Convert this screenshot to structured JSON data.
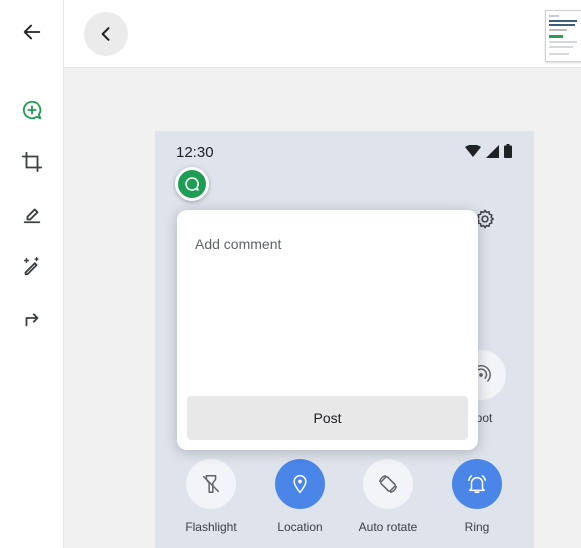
{
  "rail": {
    "items": [
      {
        "name": "back-arrow",
        "icon": "arrow-left-icon"
      },
      {
        "name": "add-comment",
        "icon": "add-comment-icon",
        "color": "#1f9d55"
      },
      {
        "name": "crop",
        "icon": "crop-icon"
      },
      {
        "name": "highlight",
        "icon": "highlighter-icon"
      },
      {
        "name": "magic-edit",
        "icon": "pen-sparkle-icon"
      },
      {
        "name": "share",
        "icon": "share-arrow-icon"
      }
    ]
  },
  "topbar": {
    "back_icon": "chevron-left-icon",
    "thumbnail_icon": "page-thumbnail"
  },
  "phone": {
    "time": "12:30",
    "status_icons": [
      "wifi-icon",
      "signal-icon",
      "battery-icon"
    ],
    "tiles": [
      {
        "label": "Flashlight",
        "icon": "flashlight-icon",
        "state": "off"
      },
      {
        "label": "Location",
        "icon": "location-pin-icon",
        "state": "on"
      },
      {
        "label": "Auto rotate",
        "icon": "auto-rotate-icon",
        "state": "off"
      },
      {
        "label": "Ring",
        "icon": "bell-ring-icon",
        "state": "on"
      }
    ],
    "partial_tile_label": "spot",
    "accent": "#4a86e8"
  },
  "comment": {
    "placeholder": "Add comment",
    "value": "",
    "post_label": "Post",
    "marker_color": "#1f9d55"
  }
}
